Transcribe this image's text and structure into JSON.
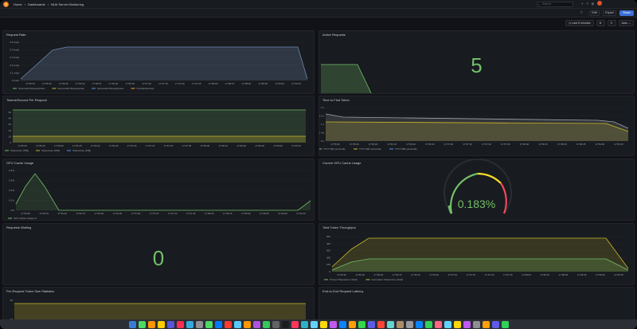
{
  "nav": {
    "home": "Home",
    "dashboards": "Dashboards",
    "dashboard": "NLM Server Monitoring",
    "search_placeholder": "Search..."
  },
  "toolbar": {
    "edit": "Edit",
    "export": "Export",
    "share": "Share"
  },
  "controls": {
    "time_range": "Last 5 minutes",
    "refresh": "Auto"
  },
  "panels": {
    "request_rate": {
      "title": "Request Rate",
      "yticks": [
        "0.5 req/s",
        "0.4 req/s",
        "0.3 req/s",
        "0.2 req/s",
        "0.1 req/s",
        "0 req/s"
      ],
      "xticks": [
        "17:55:15",
        "17:55:30",
        "17:55:45",
        "17:56:00",
        "17:56:15",
        "17:56:30",
        "17:56:45",
        "17:57:00",
        "17:57:15",
        "17:57:30",
        "17:57:45",
        "17:58:00",
        "17:58:15",
        "17:58:30",
        "17:58:45",
        "17:59:00",
        "17:59:15"
      ],
      "legend": [
        "Successful Requests/sec",
        "Successful Requests/sec",
        "Successful Requests/sec",
        "Finished/sec/sec"
      ]
    },
    "active_requests": {
      "title": "Active Requests",
      "value": "5"
    },
    "tokens_per_request": {
      "title": "Tokens/Second Per Request",
      "yticks": [
        "50",
        "40",
        "30",
        "20",
        "10",
        "0"
      ],
      "xticks": [
        "17:55:30",
        "17:55:45",
        "17:56:00",
        "17:56:15",
        "17:56:30",
        "17:56:45",
        "17:57:00",
        "17:57:15",
        "17:57:30",
        "17:57:45",
        "17:58:00",
        "17:58:15",
        "17:58:30",
        "17:58:45",
        "17:59:00",
        "17:59:15"
      ],
      "legend": [
        "Tokens/sec (P50)",
        "Tokens/sec (P90)",
        "Tokens/sec (P99)"
      ]
    },
    "time_to_first_token": {
      "title": "Time to First Token",
      "yticks": [
        "2 s",
        "1.5 s",
        "1 s",
        "500 ms",
        "0 s"
      ],
      "xticks": [
        "17:55:30",
        "17:55:45",
        "17:56:00",
        "17:56:15",
        "17:56:30",
        "17:56:45",
        "17:57:00",
        "17:57:15",
        "17:57:30",
        "17:57:45",
        "17:58:00",
        "17:58:15",
        "17:58:30",
        "17:58:45",
        "17:59:00",
        "17:59:15"
      ],
      "legend": [
        "TTFT 50th percentile",
        "TTFT 90th percentile",
        "TTFT 99th percentile"
      ]
    },
    "gpu_cache_usage": {
      "title": "GPU Cache Usage",
      "yticks": [
        "0.4%",
        "0.3%",
        "0.2%",
        "0.1%",
        "0%"
      ],
      "xticks": [
        "17:55:30",
        "17:55:45",
        "17:56:00",
        "17:56:15",
        "17:56:30",
        "17:56:45",
        "17:57:00",
        "17:57:15",
        "17:57:30",
        "17:57:45",
        "17:58:00",
        "17:58:15",
        "17:58:30",
        "17:58:45",
        "17:59:00",
        "17:59:15"
      ],
      "legend": [
        "GPU Cache Usage %"
      ]
    },
    "current_gpu_cache": {
      "title": "Current GPU Cache Usage",
      "value": "0.183%"
    },
    "requests_waiting": {
      "title": "Requests Waiting",
      "value": "0"
    },
    "total_token_throughput": {
      "title": "Total Token Throughput",
      "yticks": [
        "500",
        "400",
        "300",
        "200",
        "100",
        "0"
      ],
      "xticks": [
        "17:55:30",
        "17:55:45",
        "17:56:00",
        "17:56:15",
        "17:56:30",
        "17:56:45",
        "17:57:00",
        "17:57:15",
        "17:57:30",
        "17:57:45",
        "17:58:00",
        "17:58:15",
        "17:58:30",
        "17:58:45",
        "17:59:00",
        "17:59:15"
      ],
      "legend": [
        "Prompt Tokens/sec (Total)",
        "Generation Tokens/sec (Total)"
      ]
    },
    "per_request_token_stats": {
      "title": "Per-Request Token Size Statistics",
      "yticks": [
        "50",
        "40"
      ]
    },
    "e2e_latency": {
      "title": "End-to-End Request Latency"
    }
  },
  "colors": {
    "green": "#73bf69",
    "yellow": "#c8b72b",
    "blue": "#5794f2",
    "orange": "#ff9830",
    "teal": "#8ab8ff"
  }
}
